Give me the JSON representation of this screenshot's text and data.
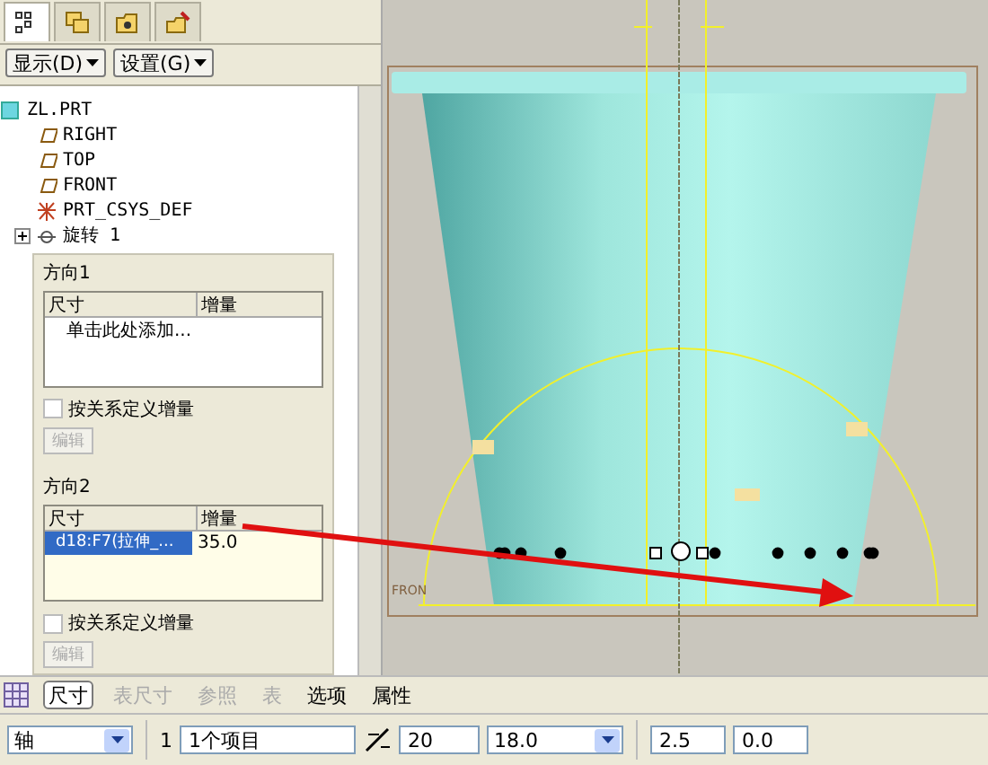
{
  "model_tree": {
    "tabs": [
      {
        "kind": "tree",
        "selected": true
      },
      {
        "kind": "layers",
        "selected": false
      },
      {
        "kind": "folder",
        "selected": false
      },
      {
        "kind": "favorites",
        "selected": false
      }
    ],
    "buttons": [
      "显示(D)",
      "设置(G)"
    ],
    "items": [
      {
        "kind": "part",
        "label": "ZL.PRT",
        "children": [
          {
            "kind": "plane",
            "label": "RIGHT"
          },
          {
            "kind": "plane",
            "label": "TOP"
          },
          {
            "kind": "plane",
            "label": "FRONT"
          },
          {
            "kind": "csys",
            "label": "PRT_CSYS_DEF"
          },
          {
            "kind": "feature",
            "label": "旋转 1",
            "expanded": false
          }
        ]
      }
    ]
  },
  "increment_panel": {
    "directions": [
      {
        "title": "方向1",
        "columns": [
          "尺寸",
          "增量"
        ],
        "add_prompt": "单击此处添加...",
        "checkbox": {
          "label": "按关系定义增量",
          "checked": false
        },
        "edit_button": {
          "label": "编辑",
          "disabled": true
        }
      },
      {
        "title": "方向2",
        "columns": [
          "尺寸",
          "增量"
        ],
        "rows": [
          {
            "dimension": "d18:F7(拉伸_...",
            "increment": "35.0",
            "selected": true
          }
        ],
        "checkbox": {
          "label": "按关系定义增量",
          "checked": false
        },
        "edit_button": {
          "label": "编辑",
          "disabled": true
        }
      }
    ]
  },
  "viewport": {
    "datum_label": "FRON"
  },
  "dashboard_tabs": [
    {
      "label": "尺寸",
      "selected": true,
      "disabled": false
    },
    {
      "label": "表尺寸",
      "selected": false,
      "disabled": true
    },
    {
      "label": "参照",
      "selected": false,
      "disabled": true
    },
    {
      "label": "表",
      "selected": false,
      "disabled": true
    },
    {
      "label": "选项",
      "selected": false,
      "disabled": false
    },
    {
      "label": "属性",
      "selected": false,
      "disabled": false
    }
  ],
  "status_bar": {
    "type_dropdown": "轴",
    "first_direction_label": "1",
    "items_field": "1个项目",
    "count_field": "20",
    "angle_dropdown": "18.0",
    "extra_fields": [
      "2.5",
      "0.0"
    ]
  }
}
